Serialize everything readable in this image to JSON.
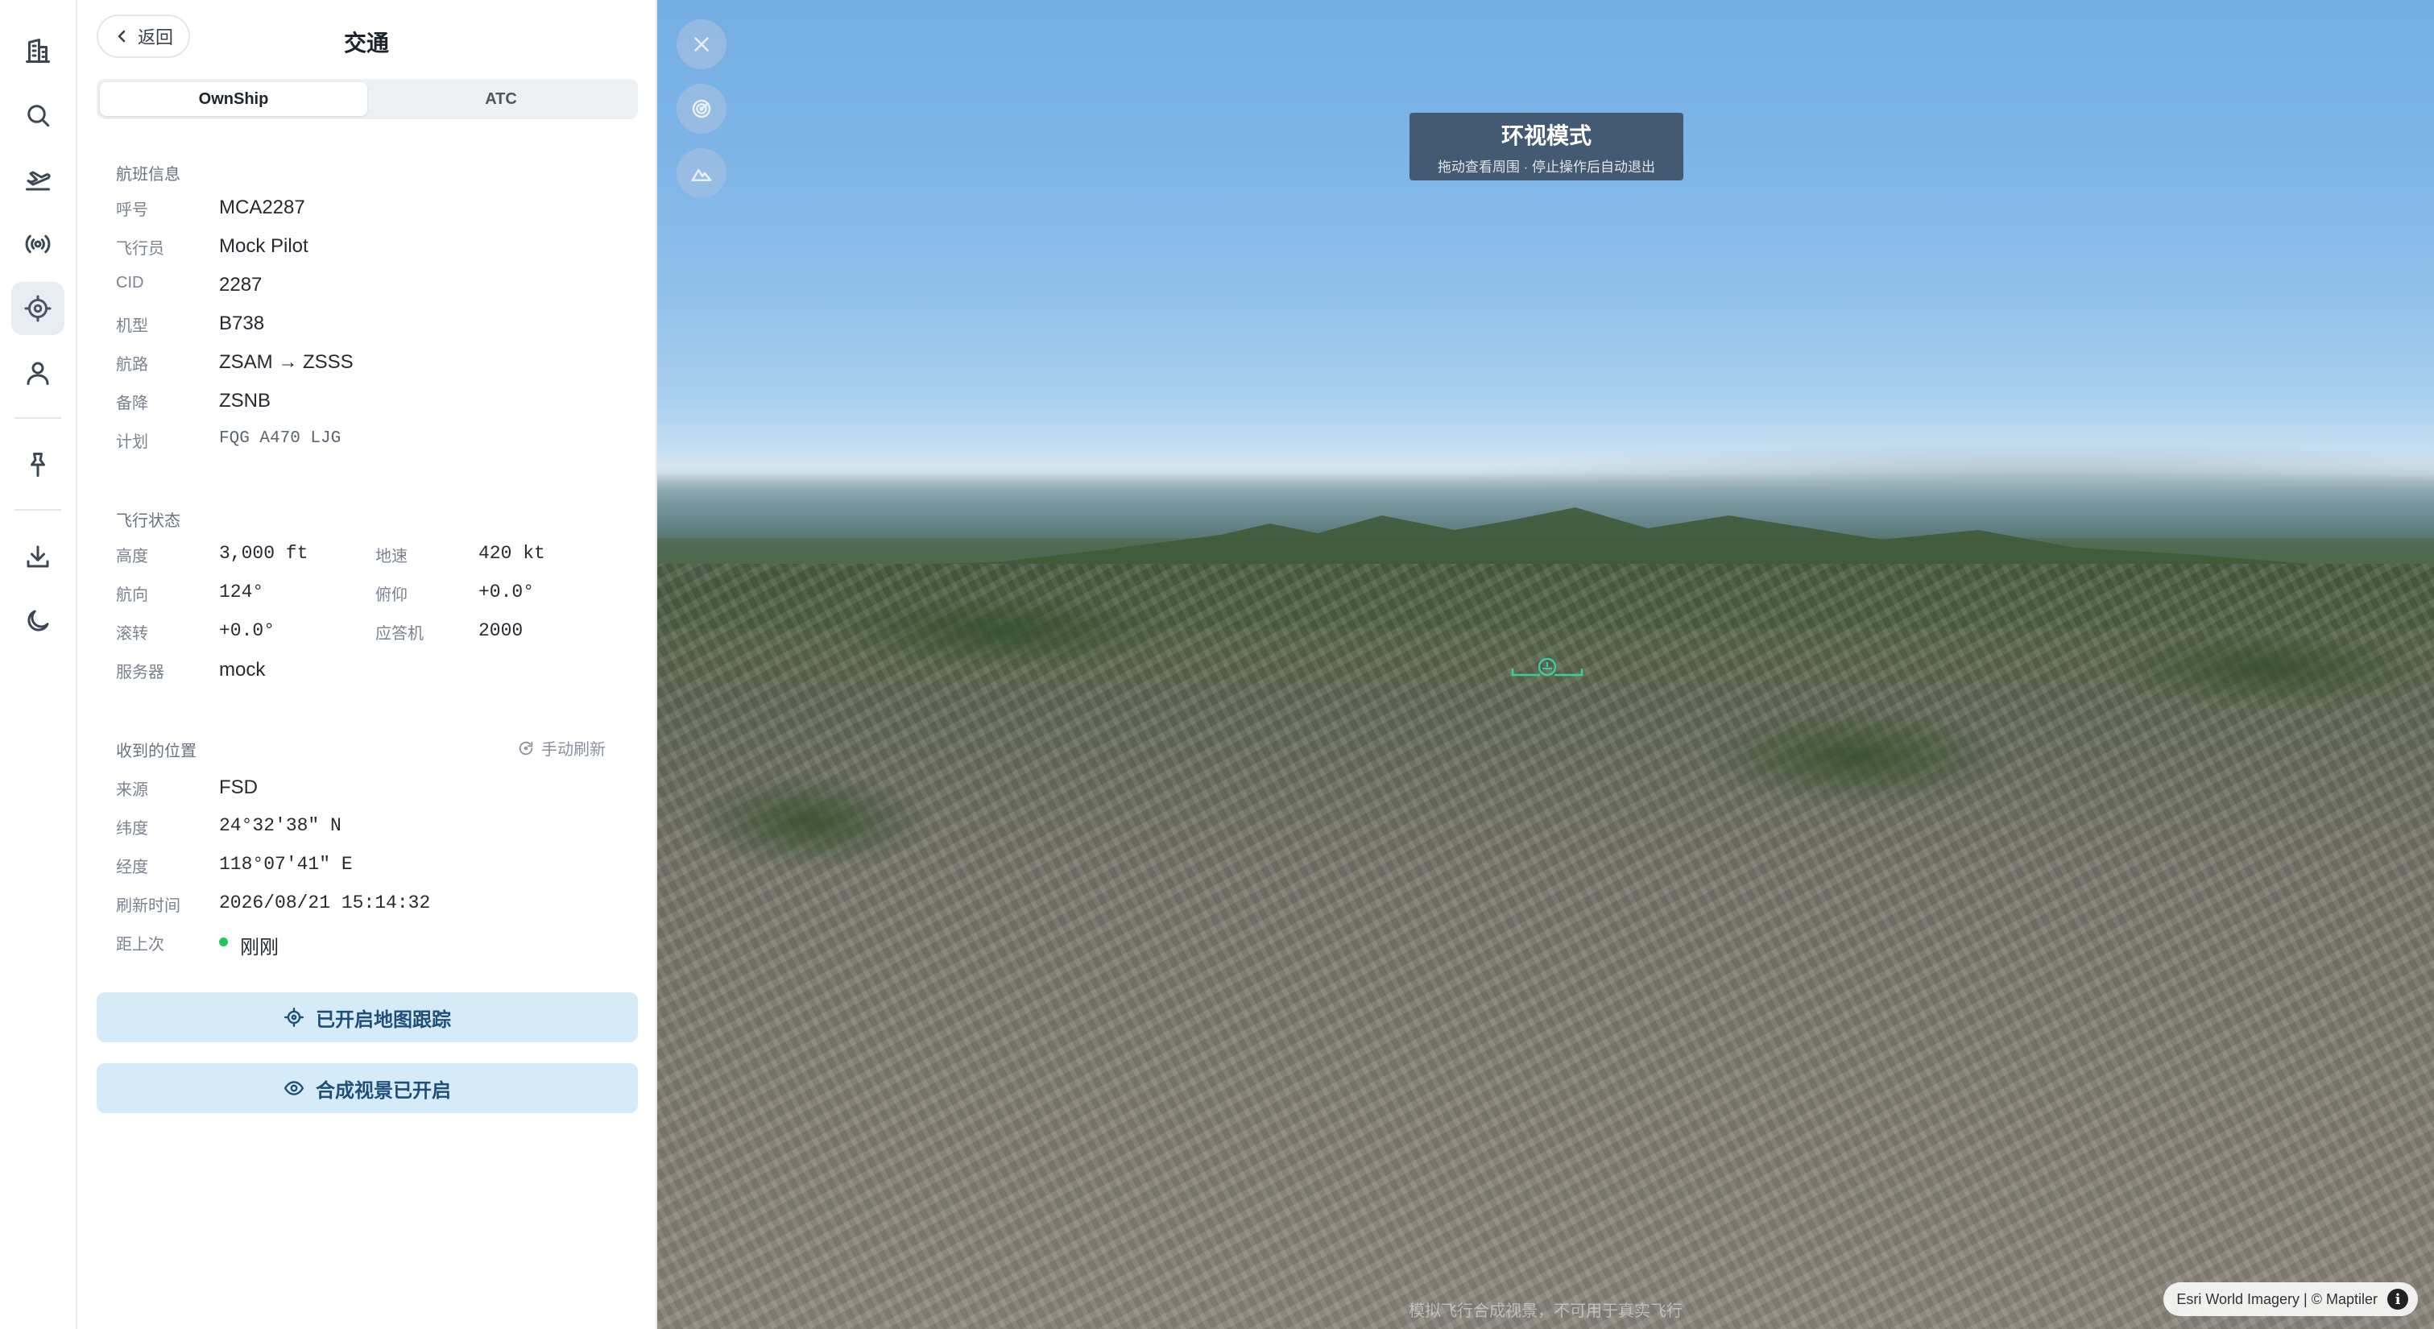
{
  "panel": {
    "back_label": "返回",
    "title": "交通",
    "tabs": [
      {
        "label": "OwnShip",
        "active": true
      },
      {
        "label": "ATC",
        "active": false
      }
    ]
  },
  "flight_info": {
    "section_title": "航班信息",
    "rows": [
      {
        "label": "呼号",
        "value": "MCA2287"
      },
      {
        "label": "飞行员",
        "value": "Mock Pilot"
      },
      {
        "label": "CID",
        "value": "2287"
      },
      {
        "label": "机型",
        "value": "B738"
      },
      {
        "label": "航路",
        "value": "ZSAM → ZSSS"
      },
      {
        "label": "备降",
        "value": "ZSNB"
      },
      {
        "label": "计划",
        "value": "FQG A470 LJG"
      }
    ]
  },
  "flight_state": {
    "section_title": "飞行状态",
    "altitude": {
      "label": "高度",
      "value": "3,000 ft"
    },
    "ground_speed": {
      "label": "地速",
      "value": "420 kt"
    },
    "heading": {
      "label": "航向",
      "value": "124°"
    },
    "pitch": {
      "label": "俯仰",
      "value": "+0.0°"
    },
    "roll": {
      "label": "滚转",
      "value": "+0.0°"
    },
    "transponder": {
      "label": "应答机",
      "value": "2000"
    },
    "server": {
      "label": "服务器",
      "value": "mock"
    }
  },
  "received_position": {
    "section_title": "收到的位置",
    "refresh_label": "手动刷新",
    "source": {
      "label": "来源",
      "value": "FSD"
    },
    "latitude": {
      "label": "纬度",
      "value": "24°32'38\" N"
    },
    "longitude": {
      "label": "经度",
      "value": "118°07'41\" E"
    },
    "updated": {
      "label": "刷新时间",
      "value": "2026/08/21 15:14:32"
    },
    "since_last": {
      "label": "距上次",
      "value": "刚刚",
      "status_color": "#22c55e"
    }
  },
  "actions": {
    "tracking": "已开启地图跟踪",
    "synthetic_view": "合成视景已开启"
  },
  "map": {
    "look_around_title": "环视模式",
    "look_around_hint": "拖动查看周围 · 停止操作后自动退出",
    "footer_note": "模拟飞行合成视景，不可用于真实飞行",
    "attribution": "Esri World Imagery | © Maptiler"
  },
  "colors": {
    "accent": "#1e4f7a",
    "action_bg": "#d5ecf8",
    "active_rail_bg": "#e7edf3"
  },
  "rail_icons": [
    "building-icon",
    "search-icon",
    "departure-icon",
    "radio-signal-icon",
    "crosshair-icon",
    "user-icon",
    "pin-icon",
    "download-icon",
    "moon-icon"
  ]
}
